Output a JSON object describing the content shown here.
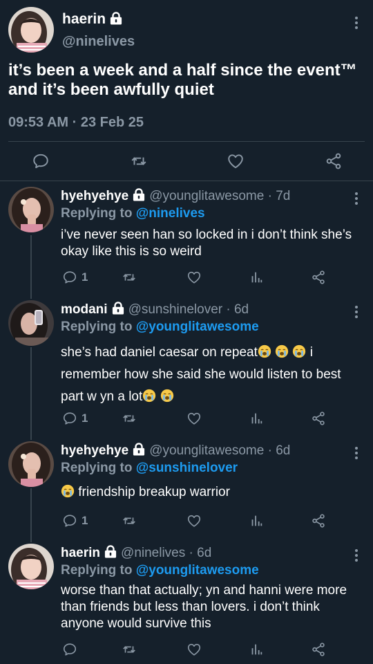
{
  "main_tweet": {
    "name": "haerin",
    "handle": "@ninelives",
    "text": "it’s been a week and a half since the event™ and it’s been awfully quiet",
    "timestamp": "09:53 AM · 23 Feb 25"
  },
  "replies": [
    {
      "name": "hyehyehye",
      "meta": "@younglitawesome · 7d",
      "replying_label": "Replying to ",
      "replying_to": "@ninelives",
      "text": "i’ve never seen han so locked in i don’t think she’s okay like this is so weird",
      "reply_count": "1"
    },
    {
      "name": "modani",
      "meta": "@sunshinelover · 6d",
      "replying_label": "Replying to ",
      "replying_to": "@younglitawesome",
      "text_a": "she’s had daniel caesar on repeat",
      "text_b": " i remember how she said she would listen to best part w yn a lot",
      "reply_count": "1"
    },
    {
      "name": "hyehyehye",
      "meta": "@younglitawesome · 6d",
      "replying_label": "Replying to ",
      "replying_to": "@sunshinelover",
      "text": " friendship breakup warrior",
      "reply_count": "1"
    },
    {
      "name": "haerin",
      "meta": "@ninelives · 6d",
      "replying_label": "Replying to ",
      "replying_to": "@younglitawesome",
      "text": "worse than that actually; yn and hanni were more than friends but less than lovers. i don’t think anyone would survive this",
      "reply_count": ""
    }
  ],
  "icons": [
    "comment-icon",
    "retweet-icon",
    "like-icon",
    "analytics-icon",
    "share-icon",
    "lock-icon",
    "more-icon",
    "crying-emoji"
  ],
  "colors": {
    "background": "#15202b",
    "muted": "#8b98a5",
    "link": "#1d9bf0",
    "divider": "#38444d"
  }
}
